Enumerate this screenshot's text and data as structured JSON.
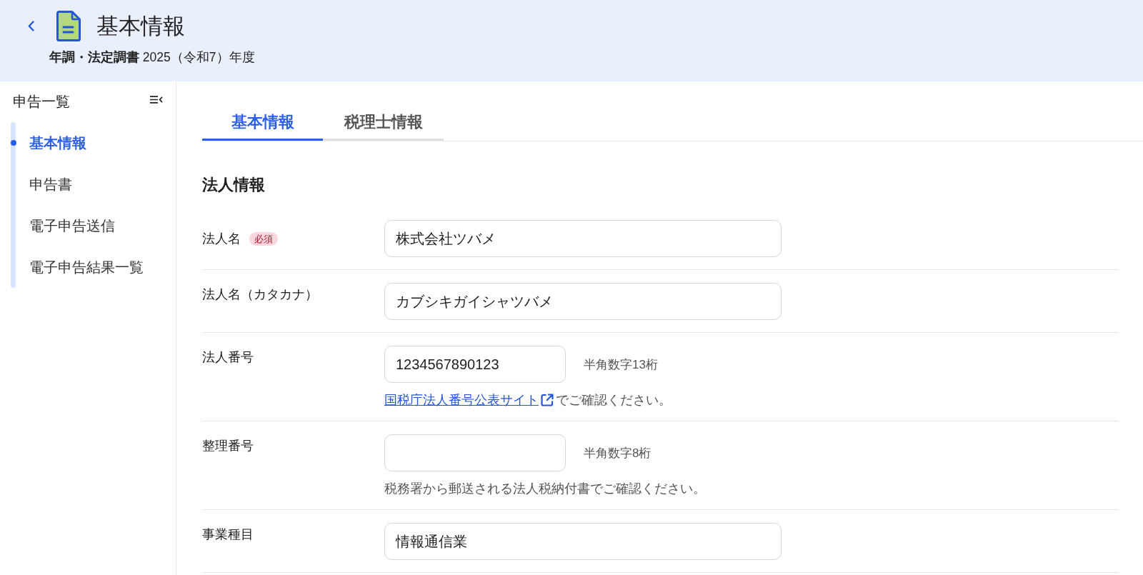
{
  "header": {
    "title": "基本情報",
    "subtitle": "**年調・法定調書** 2025（令和7）年度"
  },
  "sidebar": {
    "title": "申告一覧",
    "items": [
      {
        "label": "基本情報",
        "selected": true
      },
      {
        "label": "申告書",
        "selected": false
      },
      {
        "label": "電子申告送信",
        "selected": false
      },
      {
        "label": "電子申告結果一覧",
        "selected": false
      }
    ]
  },
  "tabs": [
    {
      "label": "基本情報",
      "selected": true
    },
    {
      "label": "税理士情報",
      "selected": false
    }
  ],
  "section": {
    "title": "法人情報",
    "fields": [
      {
        "label": "法人名",
        "badge": "必須",
        "value": "株式会社ツバメ"
      },
      {
        "label": "法人名（カタカナ）",
        "value": "カブシキガイシャツバメ"
      },
      {
        "label": "法人番号",
        "value": "1234567890123",
        "hint": "半角数字13桁",
        "note": {
          "link": "国税庁法人番号公表サイト",
          "text": "でご確認ください。"
        }
      },
      {
        "label": "整理番号",
        "hint": "半角数字8桁",
        "note": {
          "text": "税務署から郵送される法人税納付書でご確認ください。"
        }
      },
      {
        "label": "事業種目",
        "value": "情報通信業"
      }
    ]
  }
}
